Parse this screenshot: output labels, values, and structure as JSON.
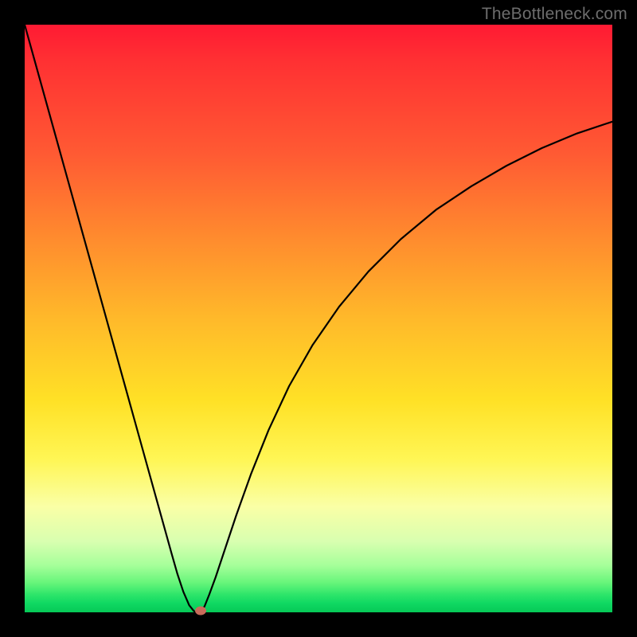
{
  "watermark": {
    "text": "TheBottleneck.com"
  },
  "chart_data": {
    "type": "line",
    "title": "",
    "xlabel": "",
    "ylabel": "",
    "xlim": [
      0,
      1
    ],
    "ylim": [
      0,
      1
    ],
    "grid": false,
    "legend": false,
    "series": [
      {
        "name": "bottleneck-curve",
        "x": [
          0.0,
          0.025,
          0.05,
          0.075,
          0.1,
          0.125,
          0.15,
          0.175,
          0.2,
          0.225,
          0.25,
          0.26,
          0.27,
          0.28,
          0.288,
          0.292,
          0.296,
          0.3,
          0.306,
          0.314,
          0.325,
          0.34,
          0.36,
          0.385,
          0.415,
          0.45,
          0.49,
          0.535,
          0.585,
          0.64,
          0.7,
          0.76,
          0.82,
          0.88,
          0.94,
          1.0
        ],
        "y": [
          1.0,
          0.91,
          0.82,
          0.73,
          0.64,
          0.55,
          0.46,
          0.37,
          0.28,
          0.19,
          0.1,
          0.065,
          0.035,
          0.012,
          0.002,
          0.0,
          0.0,
          0.002,
          0.01,
          0.03,
          0.06,
          0.105,
          0.165,
          0.235,
          0.31,
          0.385,
          0.455,
          0.52,
          0.58,
          0.635,
          0.685,
          0.725,
          0.76,
          0.79,
          0.815,
          0.835
        ]
      }
    ],
    "marker": {
      "x": 0.3,
      "y": 0.003,
      "color": "#c86b5a"
    },
    "background_gradient": {
      "stops": [
        {
          "pos": 0.0,
          "color": "#ff1a33"
        },
        {
          "pos": 0.5,
          "color": "#ffe126"
        },
        {
          "pos": 0.82,
          "color": "#faffa6"
        },
        {
          "pos": 1.0,
          "color": "#06c957"
        }
      ]
    }
  }
}
